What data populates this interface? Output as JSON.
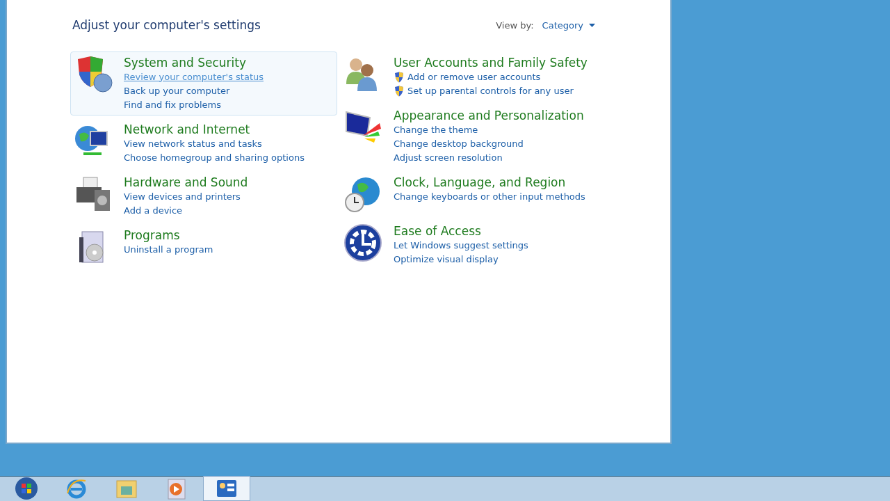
{
  "heading": "Adjust your computer's settings",
  "view_by": {
    "label": "View by:",
    "value": "Category"
  },
  "columns": [
    [
      {
        "kind": "security",
        "title": "System and Security",
        "hovered": true,
        "links": [
          {
            "text": "Review your computer's status",
            "hovered": true,
            "shield": false
          },
          {
            "text": "Back up your computer",
            "hovered": false,
            "shield": false
          },
          {
            "text": "Find and fix problems",
            "hovered": false,
            "shield": false
          }
        ]
      },
      {
        "kind": "network",
        "title": "Network and Internet",
        "hovered": false,
        "links": [
          {
            "text": "View network status and tasks",
            "hovered": false,
            "shield": false
          },
          {
            "text": "Choose homegroup and sharing options",
            "hovered": false,
            "shield": false
          }
        ]
      },
      {
        "kind": "hardware",
        "title": "Hardware and Sound",
        "hovered": false,
        "links": [
          {
            "text": "View devices and printers",
            "hovered": false,
            "shield": false
          },
          {
            "text": "Add a device",
            "hovered": false,
            "shield": false
          }
        ]
      },
      {
        "kind": "programs",
        "title": "Programs",
        "hovered": false,
        "links": [
          {
            "text": "Uninstall a program",
            "hovered": false,
            "shield": false
          }
        ]
      }
    ],
    [
      {
        "kind": "users",
        "title": "User Accounts and Family Safety",
        "hovered": false,
        "links": [
          {
            "text": "Add or remove user accounts",
            "hovered": false,
            "shield": true
          },
          {
            "text": "Set up parental controls for any user",
            "hovered": false,
            "shield": true
          }
        ]
      },
      {
        "kind": "appearance",
        "title": "Appearance and Personalization",
        "hovered": false,
        "links": [
          {
            "text": "Change the theme",
            "hovered": false,
            "shield": false
          },
          {
            "text": "Change desktop background",
            "hovered": false,
            "shield": false
          },
          {
            "text": "Adjust screen resolution",
            "hovered": false,
            "shield": false
          }
        ]
      },
      {
        "kind": "clock",
        "title": "Clock, Language, and Region",
        "hovered": false,
        "links": [
          {
            "text": "Change keyboards or other input methods",
            "hovered": false,
            "shield": false
          }
        ]
      },
      {
        "kind": "access",
        "title": "Ease of Access",
        "hovered": false,
        "links": [
          {
            "text": "Let Windows suggest settings",
            "hovered": false,
            "shield": false
          },
          {
            "text": "Optimize visual display",
            "hovered": false,
            "shield": false
          }
        ]
      }
    ]
  ],
  "taskbar": [
    {
      "kind": "start",
      "selected": false
    },
    {
      "kind": "browser",
      "selected": false
    },
    {
      "kind": "folder",
      "selected": false
    },
    {
      "kind": "media",
      "selected": false
    },
    {
      "kind": "panel",
      "selected": true
    }
  ]
}
